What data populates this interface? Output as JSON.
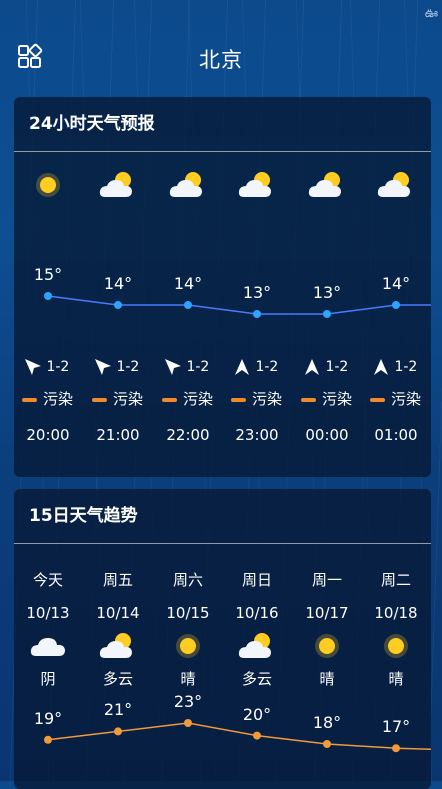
{
  "header": {
    "city": "北京",
    "menu_icon": "grid-menu-icon"
  },
  "hourly": {
    "title": "24小时天气预报",
    "items": [
      {
        "time": "20:00",
        "icon": "sun-icon",
        "temp": "15°",
        "wind": "1-2",
        "aq": "污染"
      },
      {
        "time": "21:00",
        "icon": "cloudy-icon",
        "temp": "14°",
        "wind": "1-2",
        "aq": "污染"
      },
      {
        "time": "22:00",
        "icon": "cloudy-icon",
        "temp": "14°",
        "wind": "1-2",
        "aq": "污染"
      },
      {
        "time": "23:00",
        "icon": "cloudy-icon",
        "temp": "13°",
        "wind": "1-2",
        "aq": "污染"
      },
      {
        "time": "00:00",
        "icon": "cloudy-icon",
        "temp": "13°",
        "wind": "1-2",
        "aq": "污染"
      },
      {
        "time": "01:00",
        "icon": "cloudy-icon",
        "temp": "14°",
        "wind": "1-2",
        "aq": "污染"
      }
    ],
    "temps": [
      15,
      14,
      14,
      13,
      13,
      14
    ]
  },
  "daily": {
    "title": "15日天气趋势",
    "items": [
      {
        "day": "今天",
        "date": "10/13",
        "icon": "cloud-icon",
        "cond": "阴",
        "high": "19°"
      },
      {
        "day": "周五",
        "date": "10/14",
        "icon": "cloudy-icon",
        "cond": "多云",
        "high": "21°"
      },
      {
        "day": "周六",
        "date": "10/15",
        "icon": "sun-icon",
        "cond": "晴",
        "high": "23°"
      },
      {
        "day": "周日",
        "date": "10/16",
        "icon": "cloudy-icon",
        "cond": "多云",
        "high": "20°"
      },
      {
        "day": "周一",
        "date": "10/17",
        "icon": "sun-icon",
        "cond": "晴",
        "high": "18°"
      },
      {
        "day": "周二",
        "date": "10/18",
        "icon": "sun-icon",
        "cond": "晴",
        "high": "17°"
      }
    ],
    "highs": [
      19,
      21,
      23,
      20,
      18,
      17
    ]
  },
  "colors": {
    "line_hourly": "#4a7bff",
    "line_daily": "#f09a3a",
    "aq_bar": "#f08a2c",
    "sun": "#ffcc22"
  }
}
